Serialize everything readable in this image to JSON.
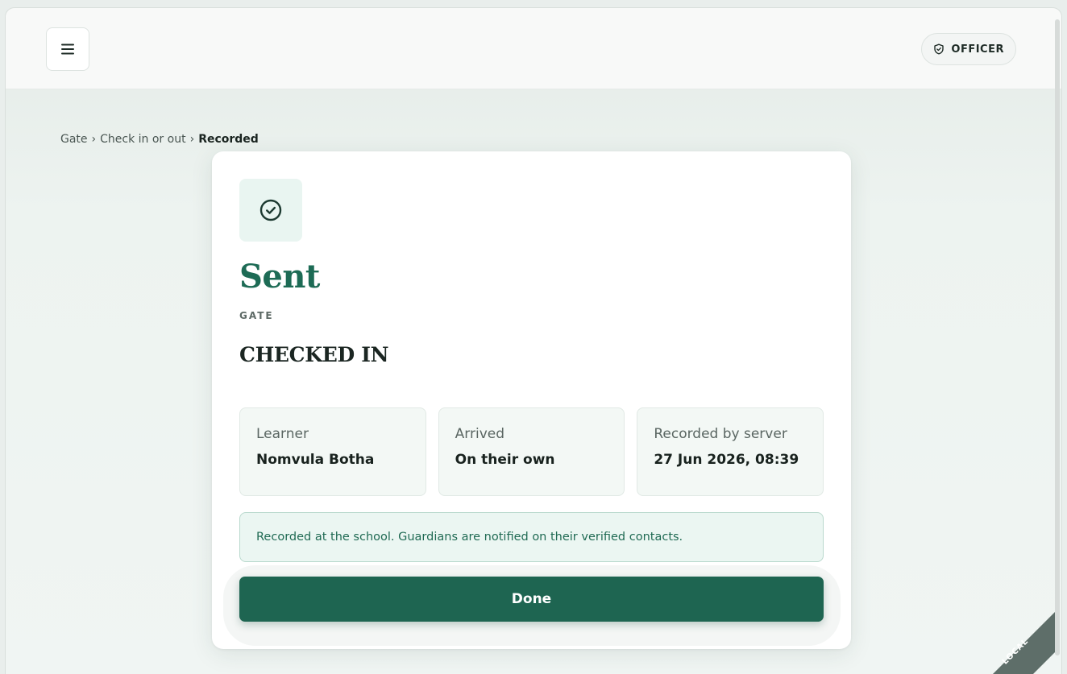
{
  "header": {
    "menu_icon": "hamburger-menu-icon",
    "role_icon": "shield-icon",
    "role_label": "OFFICER"
  },
  "breadcrumb": {
    "items": [
      "Gate",
      "Check in or out"
    ],
    "separator": "›",
    "current": "Recorded"
  },
  "result": {
    "icon": "check-circle-icon",
    "title": "Sent",
    "eyebrow": "GATE",
    "status": "CHECKED IN",
    "details": [
      {
        "label": "Learner",
        "value": "Nomvula Botha"
      },
      {
        "label": "Arrived",
        "value": "On their own"
      },
      {
        "label": "Recorded by server",
        "value": "27 Jun 2026, 08:39"
      }
    ],
    "notice": "Recorded at the school. Guardians are notified on their verified contacts.",
    "done_label": "Done"
  },
  "environment": {
    "label": "LOCAL"
  },
  "colors": {
    "accent": "#1d6b55",
    "button": "#1e6551",
    "notice_bg": "#ebf6f2"
  }
}
